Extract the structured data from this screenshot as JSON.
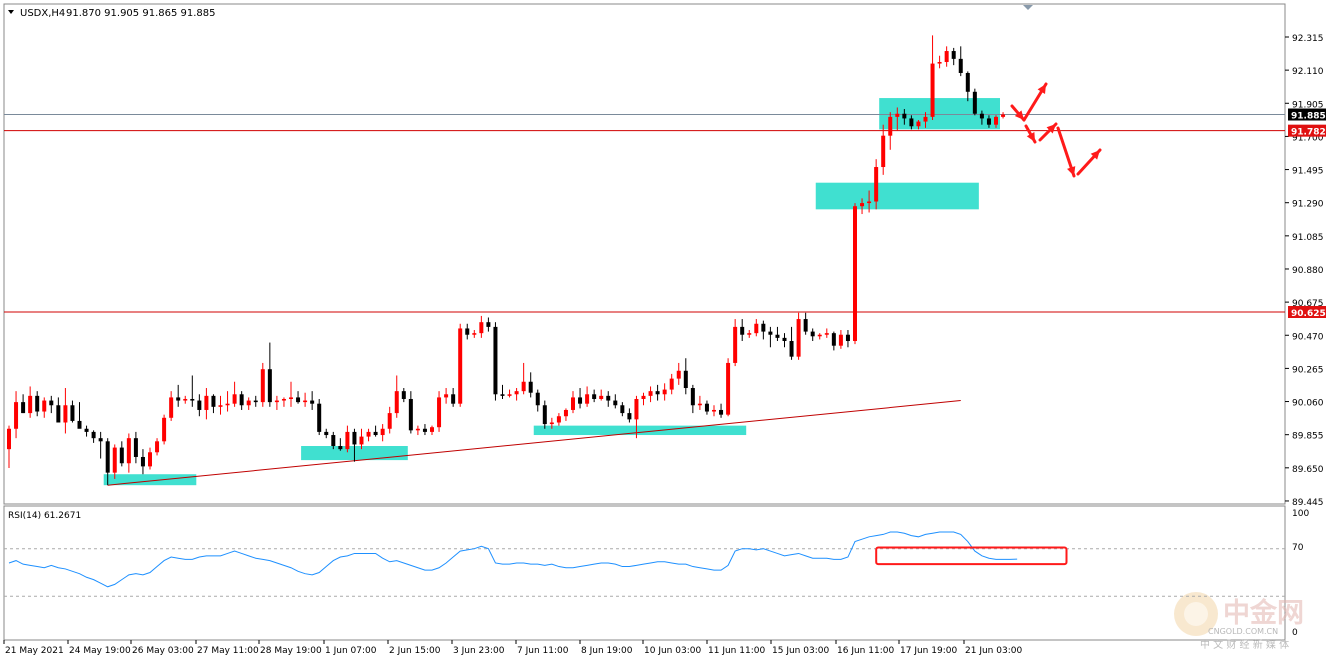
{
  "header": {
    "symbol_timeframe": "USDX,H4",
    "ohlc": "91.870 91.905 91.865 91.885"
  },
  "rsi_header": {
    "label": "RSI(14) 61.2671"
  },
  "price_axis": {
    "ticks": [
      "92.315",
      "92.110",
      "91.905",
      "91.700",
      "91.495",
      "91.290",
      "91.085",
      "90.880",
      "90.675",
      "90.470",
      "90.265",
      "90.060",
      "89.855",
      "89.650",
      "89.445"
    ],
    "current_price_tag": "91.885",
    "line_tag_1": "91.782",
    "line_tag_2": "90.625"
  },
  "rsi_axis": {
    "ticks": [
      "100",
      "70",
      "0"
    ]
  },
  "time_axis": {
    "labels": [
      "21 May 2021",
      "24 May 19:00",
      "26 May 03:00",
      "27 May 11:00",
      "28 May 19:00",
      "1 Jun 07:00",
      "2 Jun 15:00",
      "3 Jun 23:00",
      "7 Jun 11:00",
      "8 Jun 19:00",
      "10 Jun 03:00",
      "11 Jun 11:00",
      "15 Jun 03:00",
      "16 Jun 11:00",
      "17 Jun 19:00",
      "21 Jun 03:00"
    ]
  },
  "watermark": {
    "brand_cn": "中金网",
    "domain": "CNGOLD.COM.CN",
    "tagline": "中 文 财 经 新 媒 体"
  },
  "colors": {
    "bull": "#ff0000",
    "bear": "#000000",
    "zone": "#40e0d0",
    "hline": "#d00000",
    "trend": "#c00000",
    "rsi": "#1e90ff",
    "grid": "#aaaaaa"
  },
  "chart_data": {
    "type": "candlestick",
    "symbol": "USDX",
    "timeframe": "H4",
    "ylim": [
      89.4,
      92.4
    ],
    "horizontal_levels": [
      91.782,
      90.625
    ],
    "last_price": 91.885,
    "candles_ohlc": [
      [
        89.75,
        89.9,
        89.63,
        89.88
      ],
      [
        89.88,
        90.12,
        89.82,
        90.05
      ],
      [
        90.05,
        90.1,
        89.98,
        89.98
      ],
      [
        89.98,
        90.15,
        89.95,
        90.09
      ],
      [
        90.09,
        90.12,
        89.96,
        89.99
      ],
      [
        89.99,
        90.08,
        89.95,
        90.06
      ],
      [
        90.06,
        90.09,
        89.98,
        90.03
      ],
      [
        90.03,
        90.08,
        89.92,
        89.92
      ],
      [
        89.92,
        90.14,
        89.85,
        90.03
      ],
      [
        90.03,
        90.06,
        89.92,
        89.93
      ],
      [
        89.93,
        90.05,
        89.9,
        89.88
      ],
      [
        89.88,
        89.9,
        89.83,
        89.86
      ],
      [
        89.86,
        89.87,
        89.79,
        89.82
      ],
      [
        89.82,
        89.86,
        89.69,
        89.8
      ],
      [
        89.8,
        89.82,
        89.52,
        89.6
      ],
      [
        89.6,
        89.78,
        89.56,
        89.76
      ],
      [
        89.76,
        89.8,
        89.64,
        89.66
      ],
      [
        89.66,
        89.85,
        89.6,
        89.82
      ],
      [
        89.82,
        89.86,
        89.66,
        89.7
      ],
      [
        89.7,
        89.75,
        89.59,
        89.64
      ],
      [
        89.64,
        89.76,
        89.62,
        89.73
      ],
      [
        89.73,
        89.82,
        89.71,
        89.8
      ],
      [
        89.8,
        89.97,
        89.78,
        89.95
      ],
      [
        89.95,
        90.12,
        89.93,
        90.08
      ],
      [
        90.08,
        90.16,
        90.02,
        90.06
      ],
      [
        90.06,
        90.09,
        90.04,
        90.07
      ],
      [
        90.07,
        90.22,
        90.02,
        90.06
      ],
      [
        90.06,
        90.1,
        89.96,
        90.0
      ],
      [
        90.0,
        90.14,
        89.94,
        90.09
      ],
      [
        90.09,
        90.1,
        89.98,
        90.02
      ],
      [
        90.02,
        90.09,
        89.97,
        90.03
      ],
      [
        90.03,
        90.12,
        89.99,
        90.04
      ],
      [
        90.04,
        90.18,
        90.02,
        90.1
      ],
      [
        90.1,
        90.12,
        90.0,
        90.03
      ],
      [
        90.03,
        90.08,
        90.0,
        90.06
      ],
      [
        90.06,
        90.09,
        90.02,
        90.05
      ],
      [
        90.05,
        90.3,
        90.02,
        90.26
      ],
      [
        90.26,
        90.43,
        90.02,
        90.05
      ],
      [
        90.05,
        90.09,
        90.0,
        90.06
      ],
      [
        90.06,
        90.08,
        90.02,
        90.07
      ],
      [
        90.07,
        90.18,
        90.02,
        90.08
      ],
      [
        90.08,
        90.12,
        90.04,
        90.05
      ],
      [
        90.05,
        90.11,
        90.02,
        90.06
      ],
      [
        90.06,
        90.12,
        90.0,
        90.04
      ],
      [
        90.04,
        90.07,
        89.84,
        89.86
      ],
      [
        89.86,
        89.88,
        89.82,
        89.84
      ],
      [
        89.84,
        89.86,
        89.75,
        89.77
      ],
      [
        89.77,
        89.82,
        89.74,
        89.75
      ],
      [
        89.75,
        89.9,
        89.73,
        89.86
      ],
      [
        89.86,
        89.88,
        89.67,
        89.78
      ],
      [
        89.78,
        89.88,
        89.75,
        89.83
      ],
      [
        89.83,
        89.88,
        89.8,
        89.86
      ],
      [
        89.86,
        89.9,
        89.83,
        89.84
      ],
      [
        89.84,
        89.91,
        89.8,
        89.88
      ],
      [
        89.88,
        90.02,
        89.85,
        89.98
      ],
      [
        89.98,
        90.22,
        89.95,
        90.12
      ],
      [
        90.12,
        90.14,
        90.05,
        90.07
      ],
      [
        90.07,
        90.12,
        89.85,
        89.87
      ],
      [
        89.87,
        89.9,
        89.84,
        89.88
      ],
      [
        89.88,
        89.91,
        89.84,
        89.86
      ],
      [
        89.86,
        89.9,
        89.84,
        89.89
      ],
      [
        89.89,
        90.12,
        89.86,
        90.08
      ],
      [
        90.08,
        90.14,
        90.04,
        90.1
      ],
      [
        90.1,
        90.14,
        90.02,
        90.04
      ],
      [
        90.04,
        90.55,
        90.02,
        90.52
      ],
      [
        90.52,
        90.55,
        90.45,
        90.48
      ],
      [
        90.48,
        90.51,
        90.46,
        90.49
      ],
      [
        90.49,
        90.6,
        90.46,
        90.56
      ],
      [
        90.56,
        90.59,
        90.5,
        90.53
      ],
      [
        90.53,
        90.56,
        90.06,
        90.1
      ],
      [
        90.1,
        90.16,
        90.07,
        90.09
      ],
      [
        90.09,
        90.13,
        90.08,
        90.1
      ],
      [
        90.1,
        90.14,
        90.06,
        90.12
      ],
      [
        90.12,
        90.3,
        90.1,
        90.18
      ],
      [
        90.18,
        90.24,
        90.08,
        90.11
      ],
      [
        90.11,
        90.13,
        89.99,
        90.03
      ],
      [
        90.03,
        90.06,
        89.88,
        89.91
      ],
      [
        89.91,
        89.95,
        89.88,
        89.92
      ],
      [
        89.92,
        89.98,
        89.9,
        89.96
      ],
      [
        89.96,
        90.01,
        89.93,
        90.0
      ],
      [
        90.0,
        90.12,
        89.98,
        90.08
      ],
      [
        90.08,
        90.14,
        90.01,
        90.04
      ],
      [
        90.04,
        90.15,
        90.02,
        90.1
      ],
      [
        90.1,
        90.13,
        90.05,
        90.07
      ],
      [
        90.07,
        90.13,
        90.06,
        90.09
      ],
      [
        90.09,
        90.12,
        90.02,
        90.06
      ],
      [
        90.06,
        90.1,
        90.01,
        90.03
      ],
      [
        90.03,
        90.05,
        89.96,
        89.98
      ],
      [
        89.98,
        90.01,
        89.92,
        89.94
      ],
      [
        89.94,
        90.09,
        89.82,
        90.07
      ],
      [
        90.07,
        90.11,
        90.03,
        90.09
      ],
      [
        90.09,
        90.15,
        90.05,
        90.12
      ],
      [
        90.12,
        90.16,
        90.06,
        90.1
      ],
      [
        90.1,
        90.17,
        90.06,
        90.13
      ],
      [
        90.13,
        90.23,
        90.1,
        90.2
      ],
      [
        90.2,
        90.3,
        90.16,
        90.25
      ],
      [
        90.25,
        90.33,
        90.1,
        90.14
      ],
      [
        90.14,
        90.16,
        89.98,
        90.03
      ],
      [
        90.03,
        90.09,
        90.0,
        90.04
      ],
      [
        90.04,
        90.06,
        89.97,
        89.99
      ],
      [
        89.99,
        90.03,
        89.96,
        90.0
      ],
      [
        90.0,
        90.04,
        89.95,
        89.97
      ],
      [
        89.97,
        90.33,
        89.96,
        90.3
      ],
      [
        90.3,
        90.58,
        90.28,
        90.53
      ],
      [
        90.53,
        90.58,
        90.44,
        90.48
      ],
      [
        90.48,
        90.51,
        90.46,
        90.49
      ],
      [
        90.49,
        90.58,
        90.47,
        90.55
      ],
      [
        90.55,
        90.57,
        90.45,
        90.5
      ],
      [
        90.5,
        90.53,
        90.4,
        90.48
      ],
      [
        90.48,
        90.53,
        90.44,
        90.46
      ],
      [
        90.46,
        90.49,
        90.4,
        90.44
      ],
      [
        90.44,
        90.53,
        90.32,
        90.34
      ],
      [
        90.34,
        90.62,
        90.32,
        90.58
      ],
      [
        90.58,
        90.62,
        90.48,
        90.5
      ],
      [
        90.5,
        90.52,
        90.44,
        90.47
      ],
      [
        90.47,
        90.49,
        90.45,
        90.48
      ],
      [
        90.48,
        90.52,
        90.46,
        90.49
      ],
      [
        90.49,
        90.5,
        90.38,
        90.41
      ],
      [
        90.41,
        90.51,
        90.39,
        90.48
      ],
      [
        90.48,
        90.51,
        90.4,
        90.44
      ],
      [
        90.44,
        91.32,
        90.42,
        91.3
      ],
      [
        91.3,
        91.35,
        91.25,
        91.32
      ],
      [
        91.32,
        91.4,
        91.26,
        91.33
      ],
      [
        91.33,
        91.6,
        91.28,
        91.55
      ],
      [
        91.55,
        91.82,
        91.5,
        91.75
      ],
      [
        91.75,
        91.9,
        91.66,
        91.87
      ],
      [
        91.87,
        91.93,
        91.78,
        91.89
      ],
      [
        91.89,
        91.92,
        91.82,
        91.86
      ],
      [
        91.86,
        91.88,
        91.79,
        91.81
      ],
      [
        91.81,
        91.85,
        91.79,
        91.84
      ],
      [
        91.84,
        91.9,
        91.8,
        91.87
      ],
      [
        91.87,
        92.39,
        91.85,
        92.21
      ],
      [
        92.21,
        92.26,
        92.18,
        92.22
      ],
      [
        92.22,
        92.32,
        92.19,
        92.29
      ],
      [
        92.29,
        92.31,
        92.2,
        92.24
      ],
      [
        92.24,
        92.32,
        92.13,
        92.15
      ],
      [
        92.15,
        92.16,
        91.97,
        92.03
      ],
      [
        92.03,
        92.05,
        91.88,
        91.89
      ],
      [
        91.89,
        91.91,
        91.82,
        91.86
      ],
      [
        91.86,
        91.88,
        91.8,
        91.82
      ],
      [
        91.82,
        91.88,
        91.8,
        91.87
      ],
      [
        91.87,
        91.9,
        91.86,
        91.885
      ]
    ],
    "rsi": {
      "name": "RSI(14)",
      "period": 14,
      "last_value": 61.2671,
      "levels": [
        70,
        30
      ],
      "values": [
        58,
        60,
        57,
        56,
        55,
        54,
        56,
        54,
        53,
        51,
        49,
        46,
        44,
        41,
        38,
        40,
        44,
        48,
        49,
        48,
        50,
        55,
        60,
        63,
        62,
        61,
        61,
        63,
        64,
        64,
        64,
        66,
        68,
        66,
        64,
        62,
        61,
        60,
        58,
        56,
        54,
        51,
        49,
        48,
        50,
        55,
        60,
        63,
        64,
        66,
        66,
        66,
        66,
        62,
        59,
        60,
        58,
        56,
        54,
        52,
        52,
        54,
        58,
        63,
        68,
        69,
        70,
        72,
        70,
        58,
        57,
        57,
        58,
        58,
        57,
        57,
        56,
        57,
        55,
        54,
        54,
        55,
        56,
        57,
        58,
        58,
        57,
        55,
        55,
        56,
        57,
        58,
        59,
        59,
        58,
        57,
        57,
        55,
        54,
        53,
        52,
        52,
        56,
        68,
        70,
        70,
        69,
        70,
        68,
        66,
        64,
        65,
        66,
        64,
        62,
        62,
        62,
        61,
        61,
        63,
        76,
        78,
        80,
        81,
        82,
        84,
        84,
        83,
        81,
        80,
        82,
        83,
        84,
        84,
        84,
        82,
        76,
        68,
        64,
        62,
        61,
        61,
        61,
        61.2671
      ]
    },
    "support_zones": [
      {
        "from_index": 14,
        "to_index": 26,
        "low": 89.52,
        "high": 89.59
      },
      {
        "from_index": 42,
        "to_index": 56,
        "low": 89.68,
        "high": 89.77
      },
      {
        "from_index": 75,
        "to_index": 104,
        "low": 89.84,
        "high": 89.9
      },
      {
        "from_index": 115,
        "to_index": 137,
        "low": 91.28,
        "high": 91.45
      },
      {
        "from_index": 124,
        "to_index": 140,
        "low": 91.79,
        "high": 91.99
      }
    ],
    "trendline": {
      "from": [
        14,
        89.52
      ],
      "to": [
        135,
        90.06
      ]
    },
    "rsi_box": {
      "from_index": 124,
      "to_index": 150,
      "low": 57,
      "high": 71
    }
  }
}
